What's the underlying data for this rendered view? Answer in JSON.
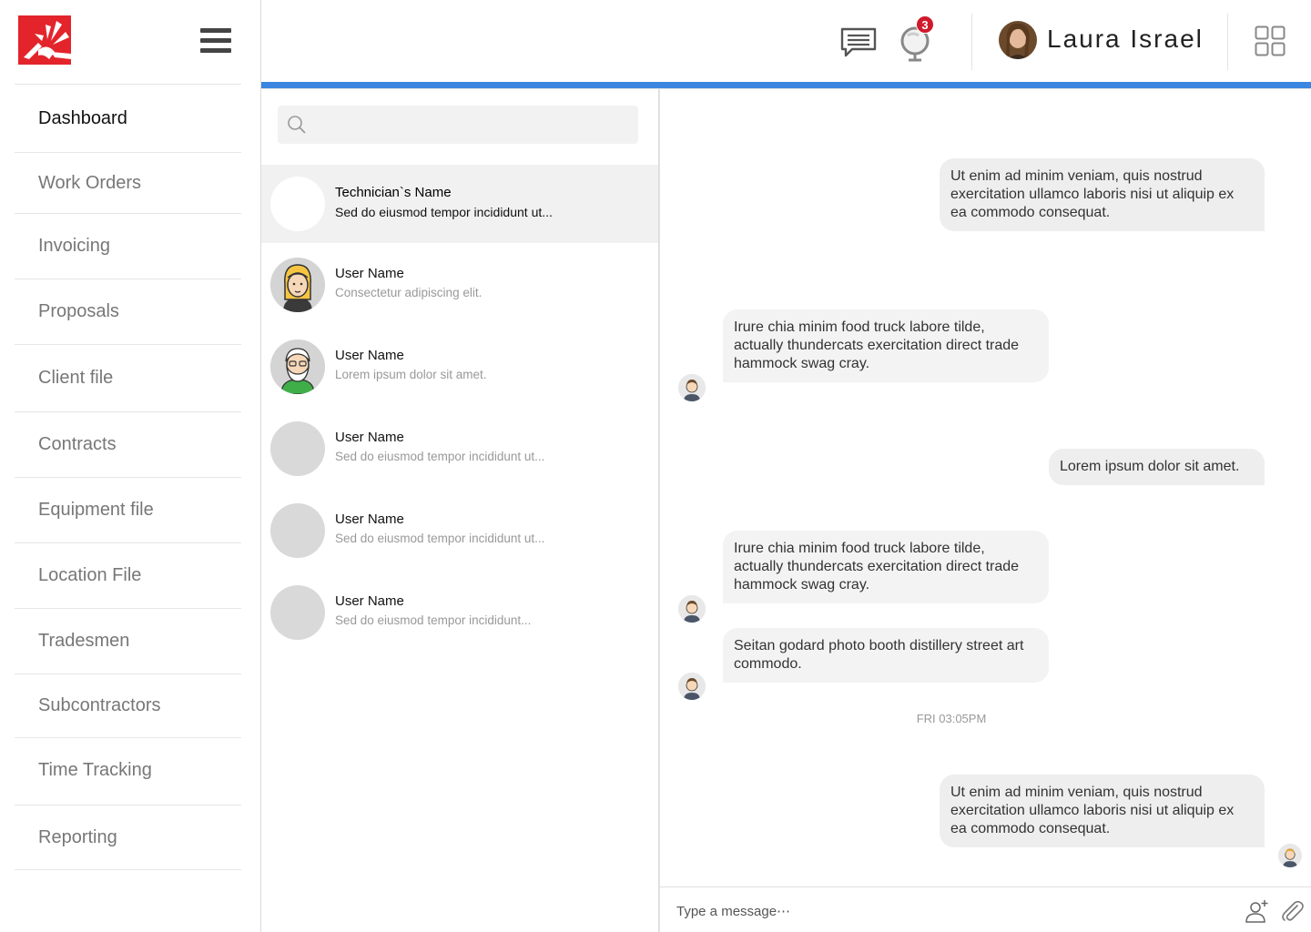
{
  "app": {
    "brand_color": "#e3242b",
    "accent_color": "#3b86e0"
  },
  "sidebar": {
    "items": [
      {
        "label": "Dashboard",
        "active": true
      },
      {
        "label": "Work Orders"
      },
      {
        "label": "Invoicing"
      },
      {
        "label": "Proposals"
      },
      {
        "label": "Client file"
      },
      {
        "label": "Contracts"
      },
      {
        "label": "Equipment file"
      },
      {
        "label": "Location File"
      },
      {
        "label": "Tradesmen"
      },
      {
        "label": "Subcontractors"
      },
      {
        "label": "Time Tracking"
      },
      {
        "label": "Reporting"
      }
    ]
  },
  "header": {
    "notification_count": "3",
    "user_name": "Laura Israel",
    "icons": [
      "chat-icon",
      "globe-icon",
      "apps-grid-icon"
    ]
  },
  "search": {
    "placeholder": ""
  },
  "conversations": [
    {
      "name": "Technician`s Name",
      "preview": "Sed do eiusmod tempor incididunt ut...",
      "active": true,
      "avatar": "blank"
    },
    {
      "name": "User Name",
      "preview": "Consectetur adipiscing elit.",
      "avatar": "blonde-woman"
    },
    {
      "name": "User Name",
      "preview": "Lorem ipsum dolor sit amet.",
      "avatar": "bearded-man"
    },
    {
      "name": "User Name",
      "preview": "Sed do eiusmod tempor incididunt ut...",
      "avatar": "gray"
    },
    {
      "name": "User Name",
      "preview": "Sed do eiusmod tempor incididunt ut...",
      "avatar": "gray"
    },
    {
      "name": "User Name",
      "preview": "Sed do eiusmod tempor incididunt...",
      "avatar": "gray"
    }
  ],
  "messages": [
    {
      "direction": "out",
      "text": "Ut enim ad minim veniam, quis nostrud exercitation ullamco laboris nisi ut aliquip ex ea commodo consequat."
    },
    {
      "direction": "in",
      "text": "Irure chia minim food truck labore tilde, actually thundercats exercitation direct trade hammock swag cray."
    },
    {
      "direction": "out",
      "text": "Lorem ipsum dolor sit amet."
    },
    {
      "direction": "in",
      "text": "Irure chia minim food truck labore tilde, actually thundercats exercitation direct trade hammock swag cray."
    },
    {
      "direction": "in",
      "text": "Seitan godard photo booth distillery street art commodo."
    },
    {
      "direction": "out",
      "text": "Ut enim ad minim veniam, quis nostrud exercitation ullamco laboris nisi ut aliquip ex ea commodo consequat."
    }
  ],
  "timestamp": "FRI 03:05PM",
  "composer": {
    "placeholder": "Type a message⋯"
  }
}
